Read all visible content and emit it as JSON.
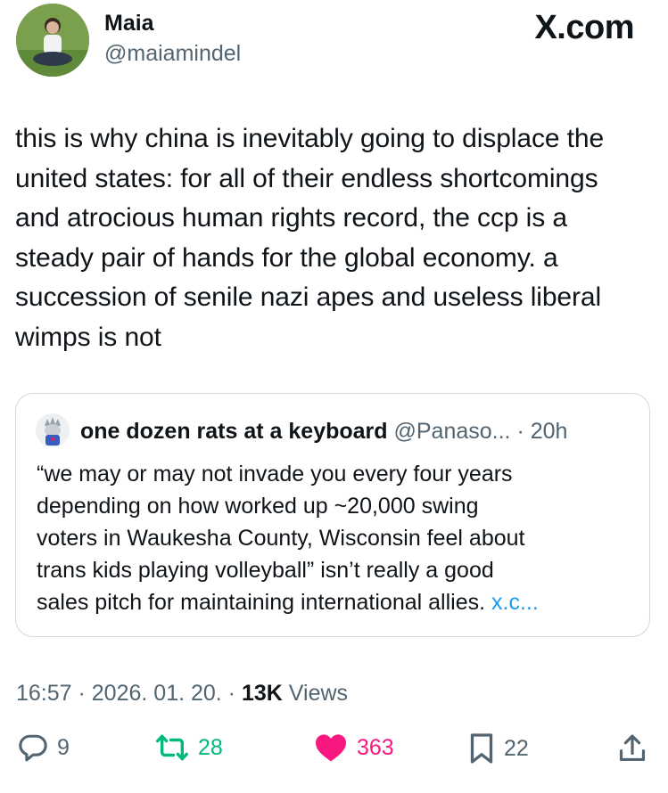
{
  "author": {
    "name": "Maia",
    "handle": "@maiamindel"
  },
  "brand": "X.com",
  "tweet": {
    "text": "this is why china is inevitably going to displace the\nunited states: for all of their endless shortcomings\nand atrocious human rights record, the ccp is a\nsteady pair of hands for the global economy. a\nsuccession of senile nazi apes and useless liberal\nwimps is not"
  },
  "quote": {
    "name": "one dozen rats at a keyboard",
    "handle": "@Panaso...",
    "time": "· 20h",
    "text": "“we may or may not invade you every four years\ndepending on how worked up ~20,000 swing\nvoters in Waukesha County, Wisconsin feel about\ntrans kids playing volleyball” isn’t really a good\nsales pitch for maintaining international allies. ",
    "link": "x.c..."
  },
  "meta": {
    "timestamp": "16:57 · 2026. 01. 20. · ",
    "views_count": "13K",
    "views_label": " Views"
  },
  "actions": {
    "replies": "9",
    "reposts": "28",
    "likes": "363",
    "bookmarks": "22"
  },
  "colors": {
    "text": "#0f1419",
    "secondary": "#536471",
    "repost": "#00ba7c",
    "like": "#f91880",
    "link": "#1d9bf0"
  },
  "icons": [
    "reply-icon",
    "repost-icon",
    "like-icon",
    "bookmark-icon",
    "share-icon"
  ]
}
